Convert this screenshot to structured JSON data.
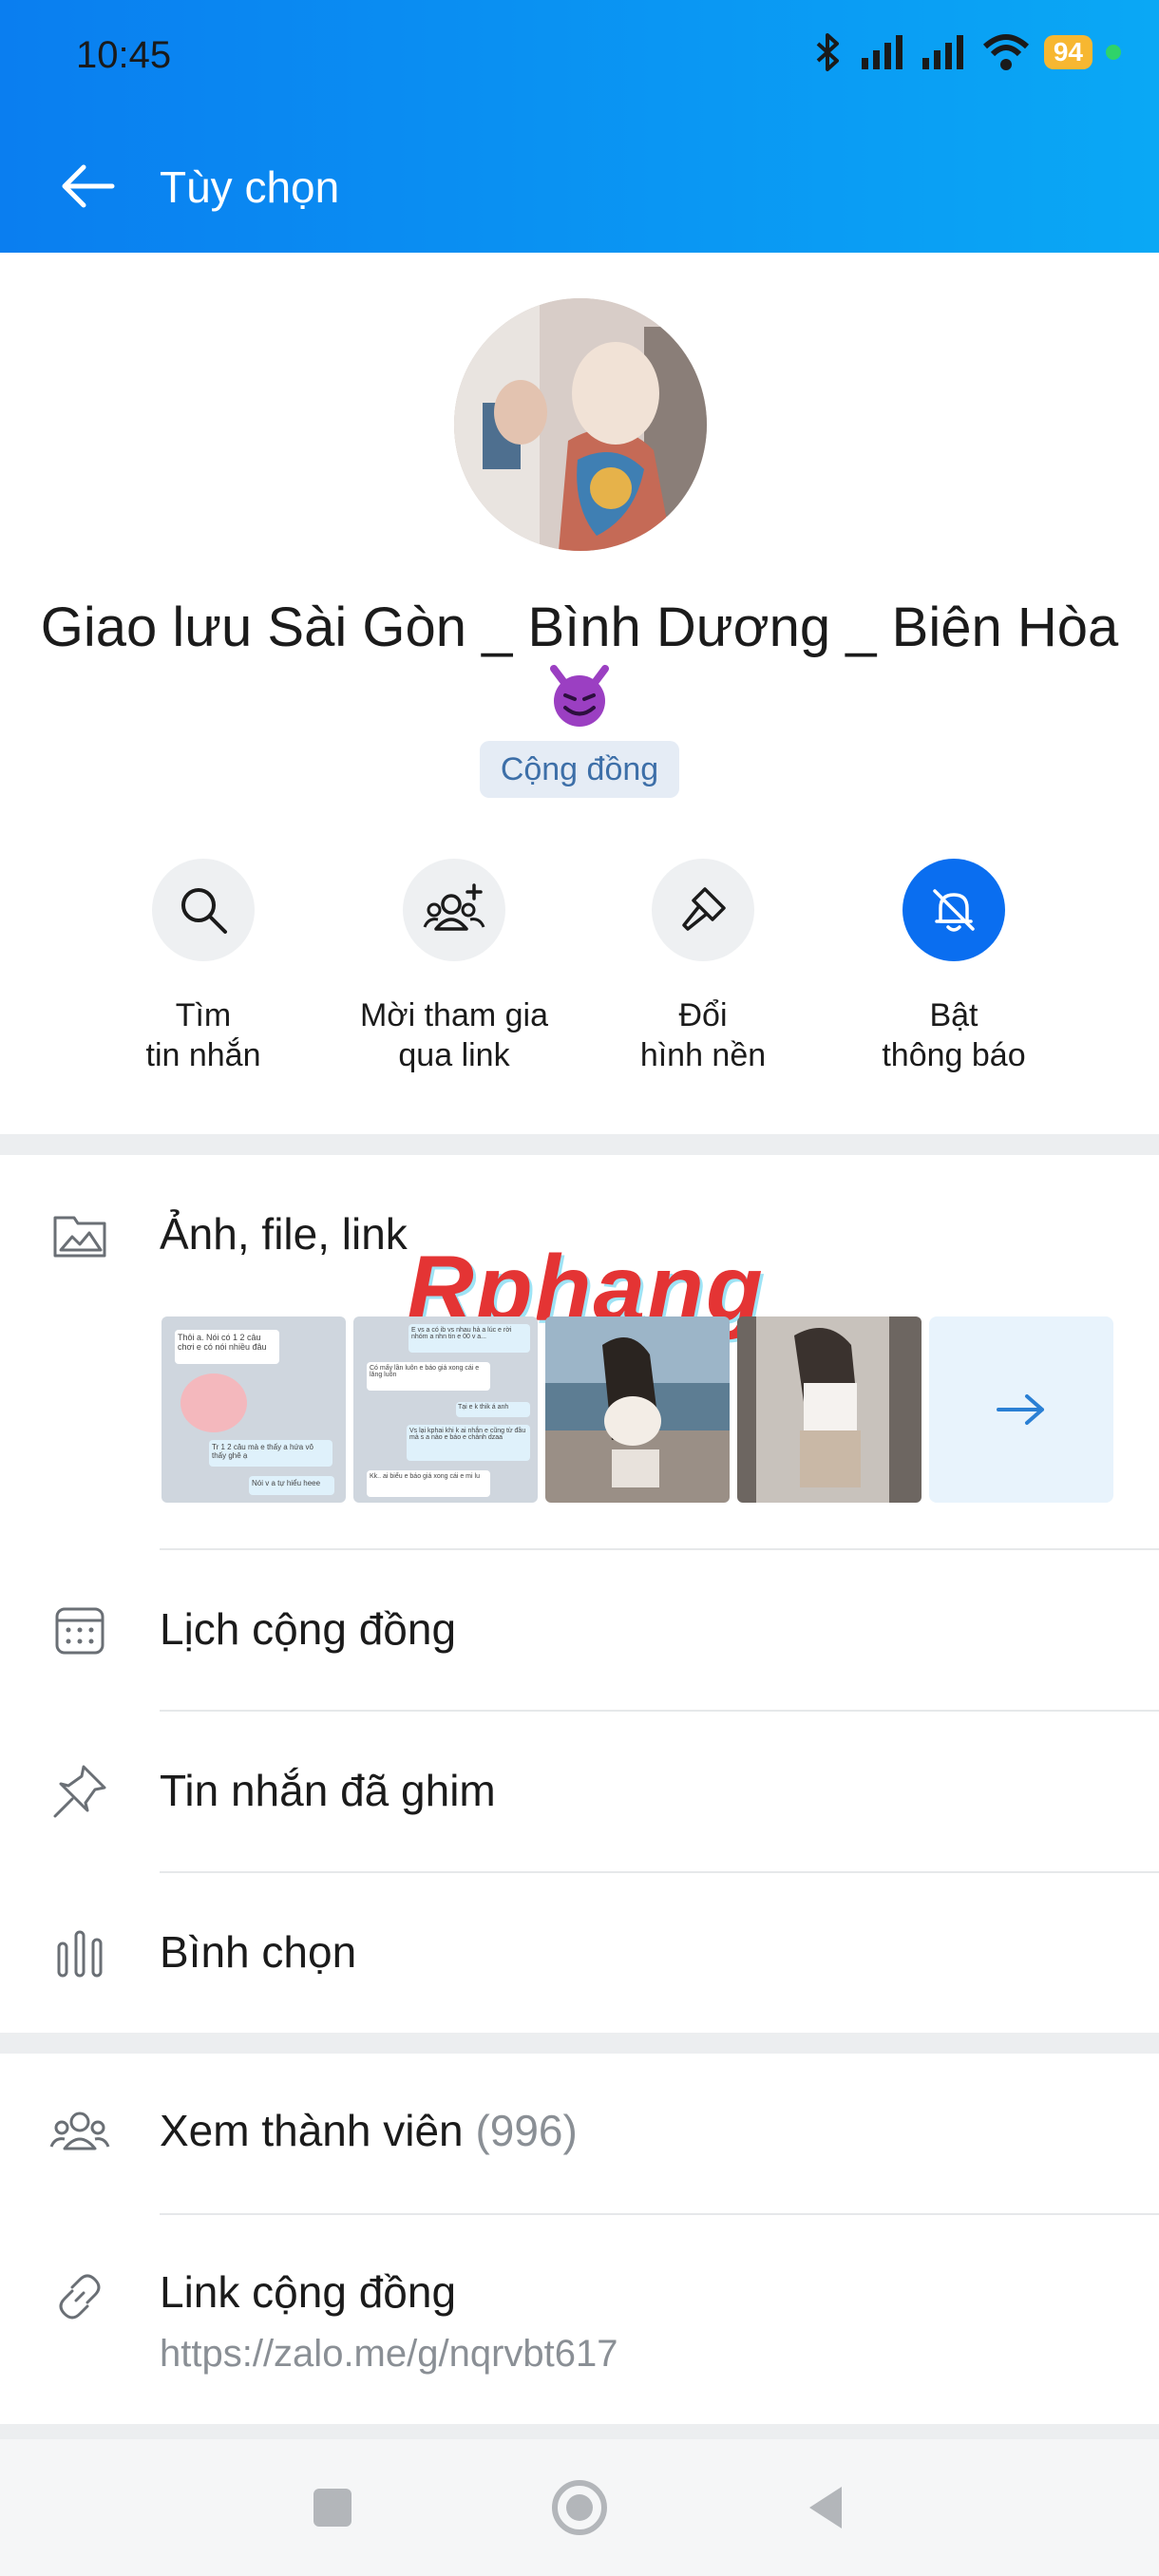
{
  "status": {
    "time": "10:45",
    "battery": "94"
  },
  "header": {
    "title": "Tùy chọn"
  },
  "profile": {
    "name": "Giao lưu Sài Gòn _ Bình Dương _ Biên Hòa",
    "badge": "Cộng đồng"
  },
  "actions": [
    {
      "label_line1": "Tìm",
      "label_line2": "tin nhắn",
      "icon": "search-icon"
    },
    {
      "label_line1": "Mời tham gia",
      "label_line2": "qua link",
      "icon": "add-people-icon"
    },
    {
      "label_line1": "Đổi",
      "label_line2": "hình nền",
      "icon": "brush-icon"
    },
    {
      "label_line1": "Bật",
      "label_line2": "thông báo",
      "icon": "bell-off-icon"
    }
  ],
  "media": {
    "label": "Ảnh, file, link",
    "watermark": "Rphang",
    "thumbs": [
      {
        "type": "chat-screenshot",
        "lines": [
          "Thôi a. Nói có 1 2 câu chơi e có nói nhiều đâu",
          "Tr 1 2 câu mà e thấy a hứa vô thấy ghê ạ",
          "Nói v a tự hiểu heee"
        ]
      },
      {
        "type": "chat-screenshot",
        "lines": [
          "E vs a có ib vs nhau hả a lúc e rời nhóm a nhn tin e 00 v a...",
          "Có mấy lần luôn e báo giá xong cái e lăng luôn",
          "Tại e k thik á anh",
          "Vs lại kphai khi k ai nhắn e cũng từ đầu mà s a nào e báo e chảnh dzaa",
          "Kk.. ai biểu e báo giá xong cái e mi lu"
        ]
      },
      {
        "type": "photo"
      },
      {
        "type": "photo"
      }
    ]
  },
  "menu": [
    {
      "label": "Lịch cộng đồng",
      "icon": "calendar-icon"
    },
    {
      "label": "Tin nhắn đã ghim",
      "icon": "pin-icon"
    },
    {
      "label": "Bình chọn",
      "icon": "poll-icon"
    }
  ],
  "members": {
    "label": "Xem thành viên",
    "count": "(996)"
  },
  "link": {
    "label": "Link cộng đồng",
    "url": "https://zalo.me/g/nqrvbt617"
  },
  "colors": {
    "header_start": "#0a7ef0",
    "header_end": "#0aa8f5",
    "accent": "#0a6ef0",
    "badge_text": "#3d6fa8"
  }
}
